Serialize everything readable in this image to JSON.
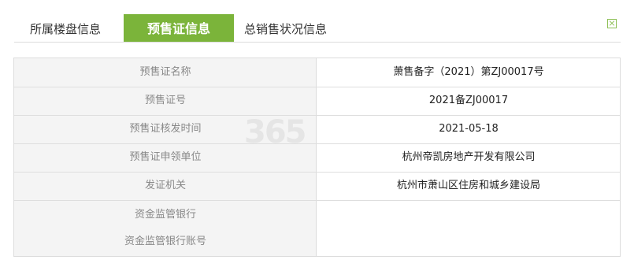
{
  "tabs": [
    {
      "label": "所属楼盘信息",
      "active": false
    },
    {
      "label": "预售证信息",
      "active": true
    },
    {
      "label": "总销售状况信息",
      "active": false
    }
  ],
  "rows": [
    {
      "label": "预售证名称",
      "value": "萧售备字（2021）第ZJ00017号"
    },
    {
      "label": "预售证号",
      "value": "2021备ZJ00017"
    },
    {
      "label": "预售证核发时间",
      "value": "2021-05-18"
    },
    {
      "label": "预售证申领单位",
      "value": "杭州帝凯房地产开发有限公司"
    },
    {
      "label": "发证机关",
      "value": "杭州市萧山区住房和城乡建设局"
    },
    {
      "label": "资金监管银行",
      "value": ""
    },
    {
      "label": "资金监管银行账号",
      "value": ""
    }
  ],
  "watermark": "365",
  "colors": {
    "accent": "#7bb43a",
    "label_bg": "#f4f4f4",
    "border": "#dcdcdc"
  },
  "icons": {
    "close": "close-icon"
  }
}
